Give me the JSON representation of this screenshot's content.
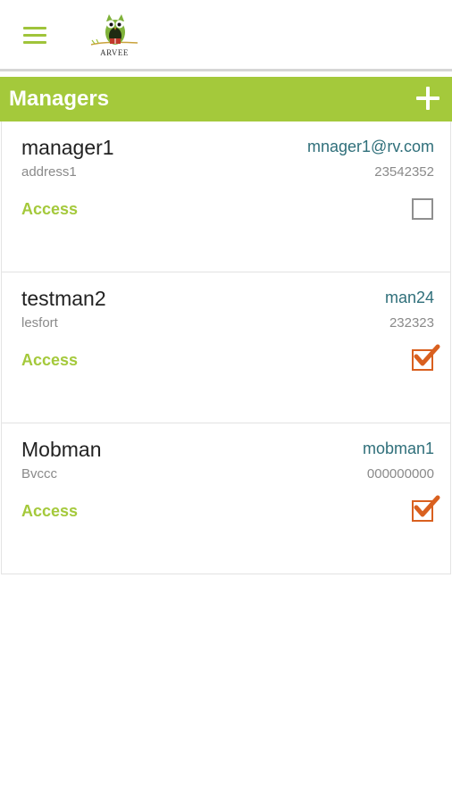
{
  "app": {
    "logo_text": "ARVEE",
    "brand_color": "#a4c93b",
    "check_color": "#d9601f"
  },
  "header": {
    "title": "Managers"
  },
  "managers": [
    {
      "name": "manager1",
      "email": "mnager1@rv.com",
      "address": "address1",
      "phone": "23542352",
      "access_label": "Access",
      "access": false
    },
    {
      "name": "testman2",
      "email": "man24",
      "address": "lesfort",
      "phone": "232323",
      "access_label": "Access",
      "access": true
    },
    {
      "name": "Mobman",
      "email": "mobman1",
      "address": "Bvccc",
      "phone": "000000000",
      "access_label": "Access",
      "access": true
    }
  ]
}
